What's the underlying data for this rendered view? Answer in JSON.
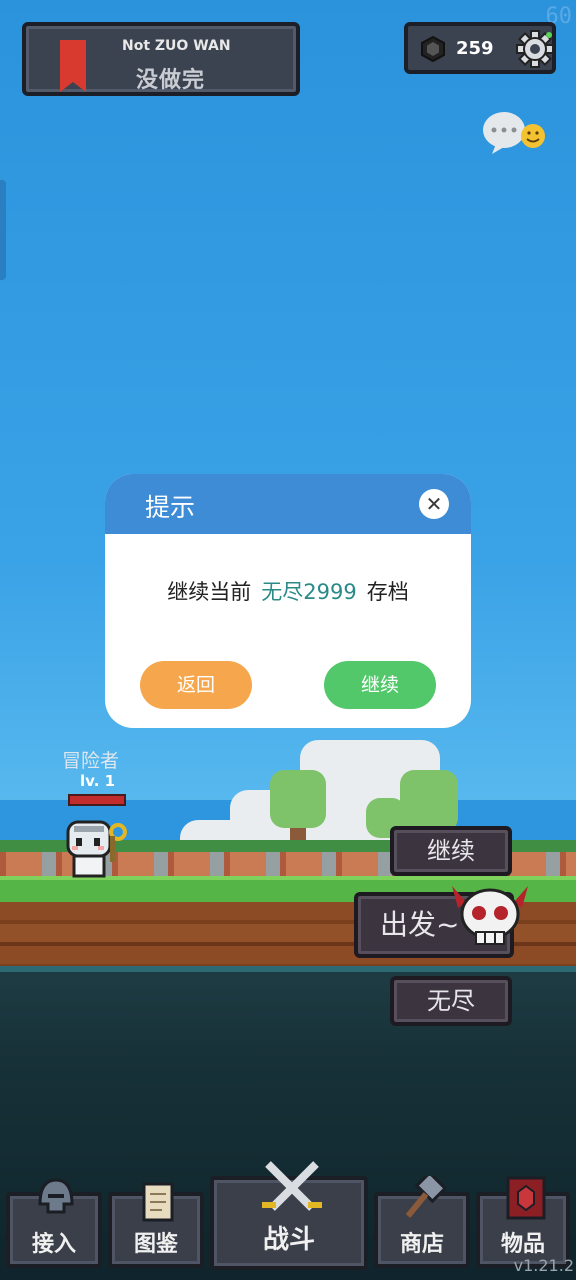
{
  "fps": "60",
  "title_panel": {
    "subtitle_en": "Not ZUO WAN",
    "title_cn": "没做完"
  },
  "currency": {
    "gem_count": "259"
  },
  "hero": {
    "name": "冒险者",
    "level": "lv. 1"
  },
  "actions": {
    "continue": "继续",
    "depart": "出发~",
    "endless": "无尽"
  },
  "dialog": {
    "title": "提示",
    "close_glyph": "✕",
    "msg_prefix": "继续当前",
    "msg_highlight": "无尽2999",
    "msg_suffix": "存档",
    "back_label": "返回",
    "continue_label": "继续"
  },
  "nav": {
    "items": [
      {
        "label": "接入"
      },
      {
        "label": "图鉴"
      },
      {
        "label": "战斗"
      },
      {
        "label": "商店"
      },
      {
        "label": "物品"
      }
    ]
  },
  "version": "v1.21.2",
  "colors": {
    "dialog_header": "#3e8bd6",
    "back_button": "#f6a74e",
    "continue_button": "#52c86a",
    "highlight_text": "#2b8a87"
  }
}
